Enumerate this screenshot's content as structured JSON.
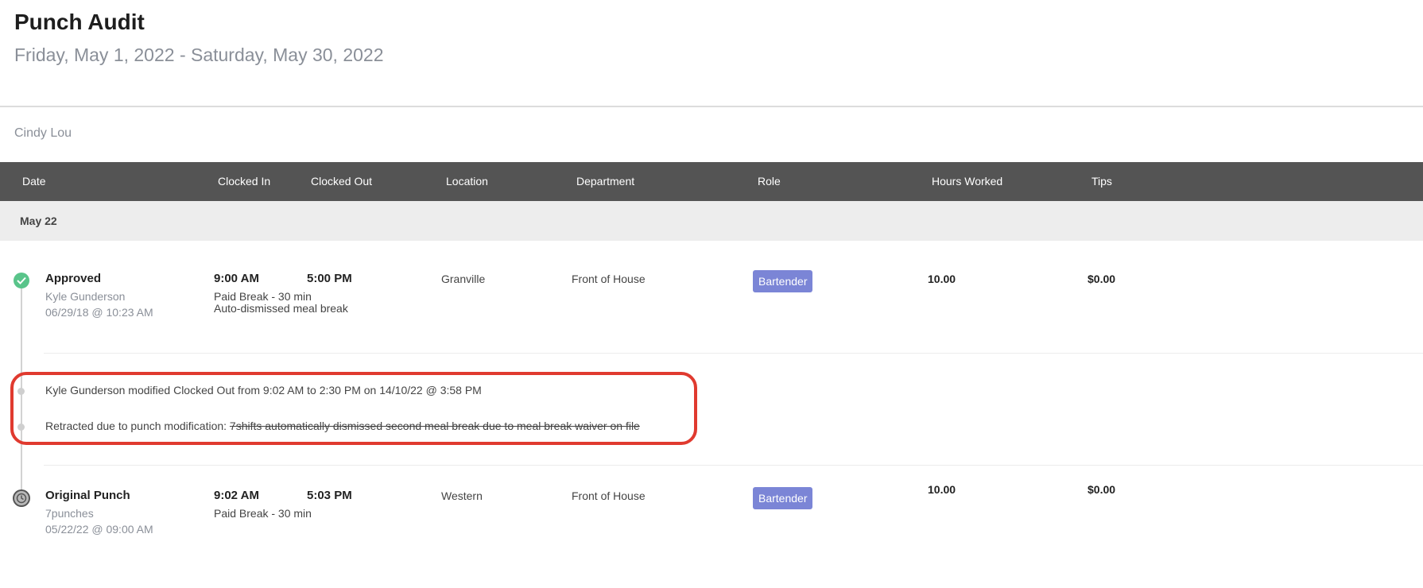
{
  "page": {
    "title": "Punch Audit",
    "date_range": "Friday, May 1, 2022 - Saturday, May 30, 2022",
    "employee": "Cindy Lou"
  },
  "table": {
    "columns": [
      "Date",
      "Clocked In",
      "Clocked Out",
      "Location",
      "Department",
      "Role",
      "Hours Worked",
      "Tips"
    ],
    "date_group": "May 22",
    "approved_row": {
      "status": "Approved",
      "user": "Kyle Gunderson",
      "timestamp": "06/29/18 @ 10:23 AM",
      "clocked_in": "9:00 AM",
      "clocked_out": "5:00 PM",
      "note1": "Paid Break - 30 min",
      "note2": "Auto-dismissed meal break",
      "location": "Granville",
      "department": "Front of House",
      "role": "Bartender",
      "hours": "10.00",
      "tips": "$0.00",
      "status_icon": "check-circle-icon"
    },
    "audit": {
      "modification": "Kyle Gunderson modified Clocked Out from 9:02 AM to 2:30 PM on 14/10/22 @ 3:58 PM",
      "retracted_label": "Retracted due to punch modification:",
      "retracted_text": "7shifts automatically dismissed second meal break due to meal break waiver on file"
    },
    "original_row": {
      "status": "Original Punch",
      "user": "7punches",
      "timestamp": "05/22/22 @ 09:00 AM",
      "clocked_in": "9:02 AM",
      "clocked_out": "5:03 PM",
      "note1": "Paid Break - 30 min",
      "location": "Western",
      "department": "Front of House",
      "role": "Bartender",
      "hours": "10.00",
      "tips": "$0.00",
      "status_icon": "clock-icon"
    }
  },
  "colors": {
    "header_bg": "#545454",
    "approved": "#59c48a",
    "badge": "#7b85d6",
    "highlight_border": "#e03a2f"
  }
}
